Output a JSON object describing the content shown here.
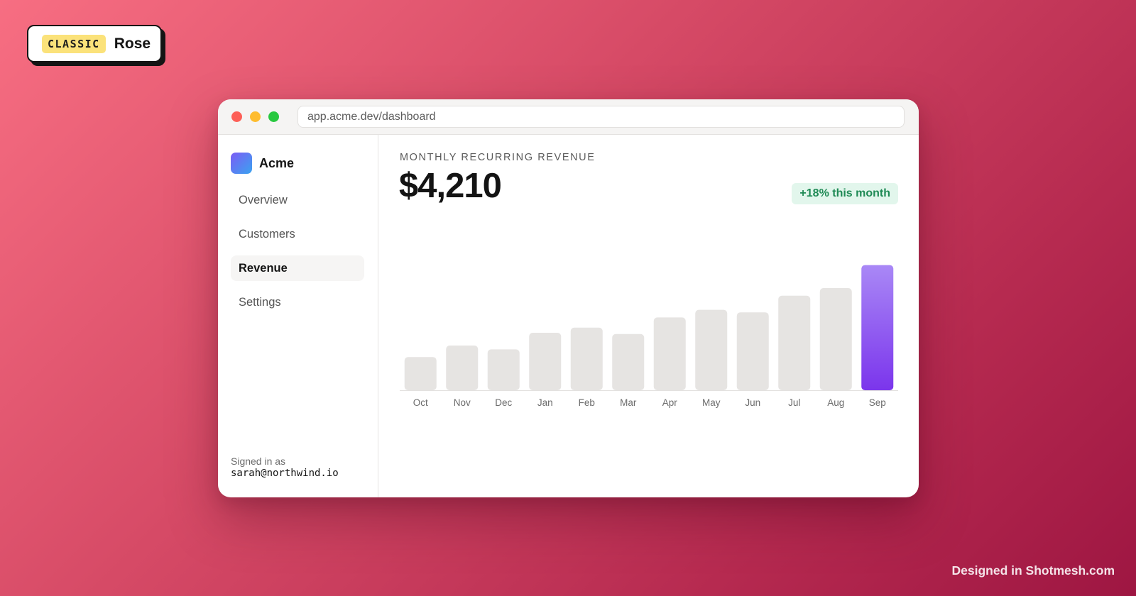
{
  "badge": {
    "chip": "CLASSIC",
    "label": "Rose"
  },
  "browser": {
    "url": "app.acme.dev/dashboard"
  },
  "sidebar": {
    "brand": "Acme",
    "items": [
      {
        "label": "Overview",
        "active": false
      },
      {
        "label": "Customers",
        "active": false
      },
      {
        "label": "Revenue",
        "active": true
      },
      {
        "label": "Settings",
        "active": false
      }
    ],
    "signed_in_label": "Signed in as",
    "email": "sarah@northwind.io"
  },
  "main": {
    "eyebrow": "MONTHLY RECURRING REVENUE",
    "metric": "$4,210",
    "delta": "+18% this month"
  },
  "chart_data": {
    "type": "bar",
    "categories": [
      "Oct",
      "Nov",
      "Dec",
      "Jan",
      "Feb",
      "Mar",
      "Apr",
      "May",
      "Jun",
      "Jul",
      "Aug",
      "Sep"
    ],
    "values": [
      26,
      35,
      32,
      45,
      49,
      44,
      57,
      63,
      61,
      74,
      80,
      98
    ],
    "ylim": [
      0,
      100
    ],
    "highlight_index": 11,
    "bar_color": "#e6e4e2",
    "highlight_gradient": [
      "#a988f6",
      "#7b35ec"
    ],
    "grid": false
  },
  "footer": {
    "credit": "Designed in Shotmesh.com"
  },
  "colors": {
    "accent_positive": "#1f8a55",
    "accent_purple": "#7b35ec",
    "traffic_red": "#fd5f57",
    "traffic_yellow": "#febc2e",
    "traffic_green": "#28c840"
  }
}
